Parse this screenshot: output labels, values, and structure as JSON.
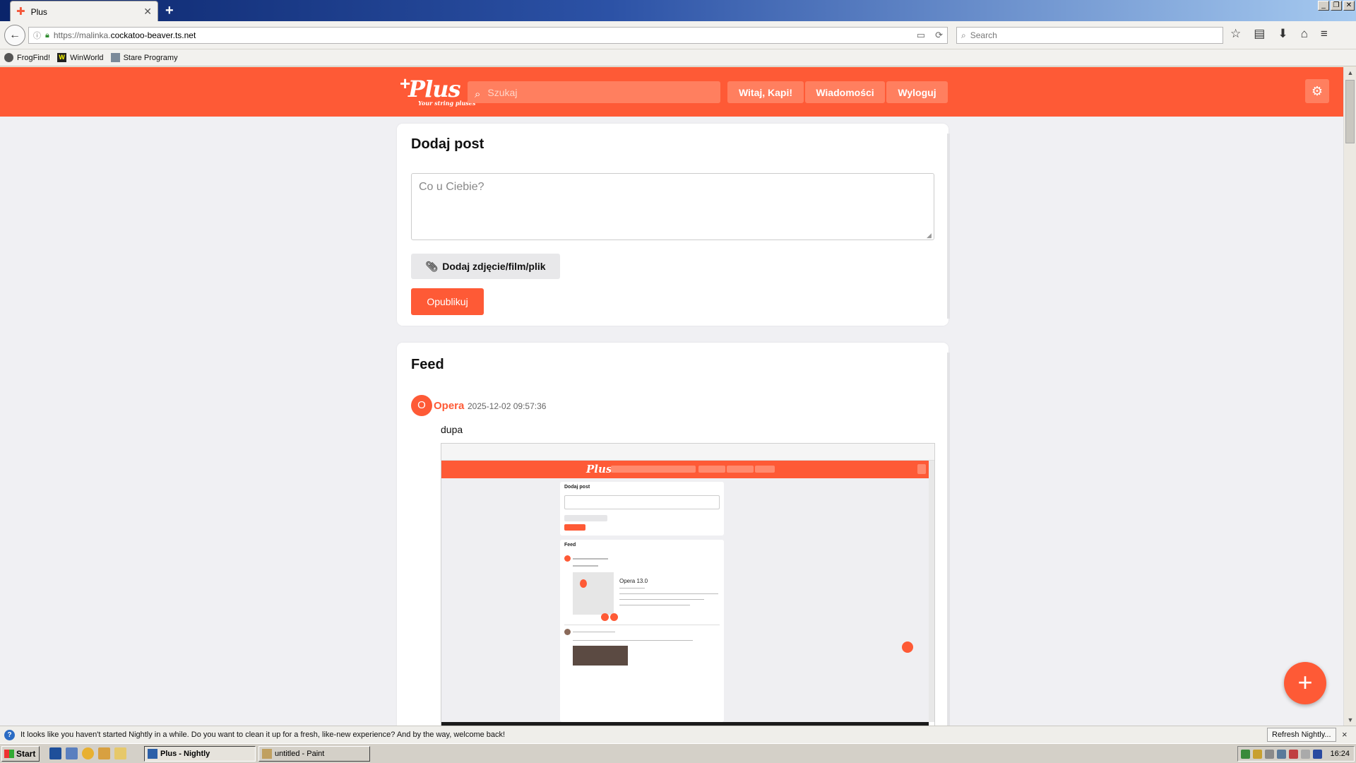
{
  "browser": {
    "tab_title": "Plus",
    "new_tab": "+",
    "url_prefix": "https://malinka.",
    "url_domain": "cockatoo-beaver.ts.net",
    "search_placeholder": "Search"
  },
  "bookmarks": [
    {
      "label": "FrogFind!"
    },
    {
      "label": "WinWorld"
    },
    {
      "label": "Stare Programy"
    }
  ],
  "site": {
    "logo": "Plus",
    "tagline": "Your string pluses",
    "search_placeholder": "Szukaj",
    "nav": {
      "welcome": "Witaj, Kapi!",
      "messages": "Wiadomości",
      "logout": "Wyloguj"
    },
    "accent_color": "#fe5a36"
  },
  "add_post": {
    "title": "Dodaj post",
    "placeholder": "Co u Ciebie?",
    "attach_label": "Dodaj zdjęcie/film/plik",
    "publish_label": "Opublikuj"
  },
  "feed": {
    "title": "Feed",
    "posts": [
      {
        "avatar_letter": "O",
        "author": "Opera",
        "date": "2025-12-02 09:57:36",
        "text": "dupa"
      }
    ]
  },
  "embedded_screenshot": {
    "logo": "Plus",
    "add_title": "Dodaj post",
    "feed_title": "Feed",
    "opera_version": "Opera 13.0"
  },
  "fab_label": "+",
  "notification": {
    "message": "It looks like you haven't started Nightly in a while. Do you want to clean it up for a fresh, like-new experience? And by the way, welcome back!",
    "refresh_label": "Refresh Nightly...",
    "close": "×"
  },
  "taskbar": {
    "start": "Start",
    "tasks": [
      "Plus - Nightly",
      "untitled - Paint"
    ],
    "clock": "16:24"
  }
}
